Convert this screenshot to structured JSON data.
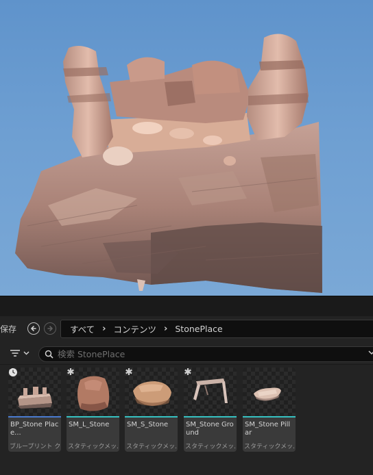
{
  "viewport": {
    "scene": "stone-formation-render",
    "colors": {
      "sky": "#6e9fd2",
      "rock": "#c9a393",
      "shadow": "#5d4a46"
    }
  },
  "nav": {
    "save_label": "保存",
    "back_icon": "arrow-left-circle-icon",
    "forward_icon": "arrow-right-circle-icon",
    "breadcrumb": [
      "すべて",
      "コンテンツ",
      "StonePlace"
    ]
  },
  "filter": {
    "filter_icon": "filter-lines-icon",
    "search_icon": "search-icon",
    "search_placeholder": "検索 StonePlace",
    "search_value": ""
  },
  "assets": [
    {
      "name": "BP_Stone Place...",
      "type_label": "ブループリント ク...",
      "type_color": "#4a7bd0",
      "thumb": "blueprint-stone-place",
      "has_clock": true
    },
    {
      "name": "SM_L_Stone",
      "type_label": "スタティックメッ...",
      "type_color": "#36c2c2",
      "thumb": "large-stone",
      "has_clock": false
    },
    {
      "name": "SM_S_Stone",
      "type_label": "スタティックメッ...",
      "type_color": "#36c2c2",
      "thumb": "small-stone",
      "has_clock": false
    },
    {
      "name": "SM_Stone Ground",
      "type_label": "スタティックメッ...",
      "type_color": "#36c2c2",
      "thumb": "stone-ground",
      "has_clock": false
    },
    {
      "name": "SM_Stone Pillar",
      "type_label": "スタティックメッ...",
      "type_color": "#36c2c2",
      "thumb": "stone-pillar",
      "has_clock": false
    }
  ]
}
